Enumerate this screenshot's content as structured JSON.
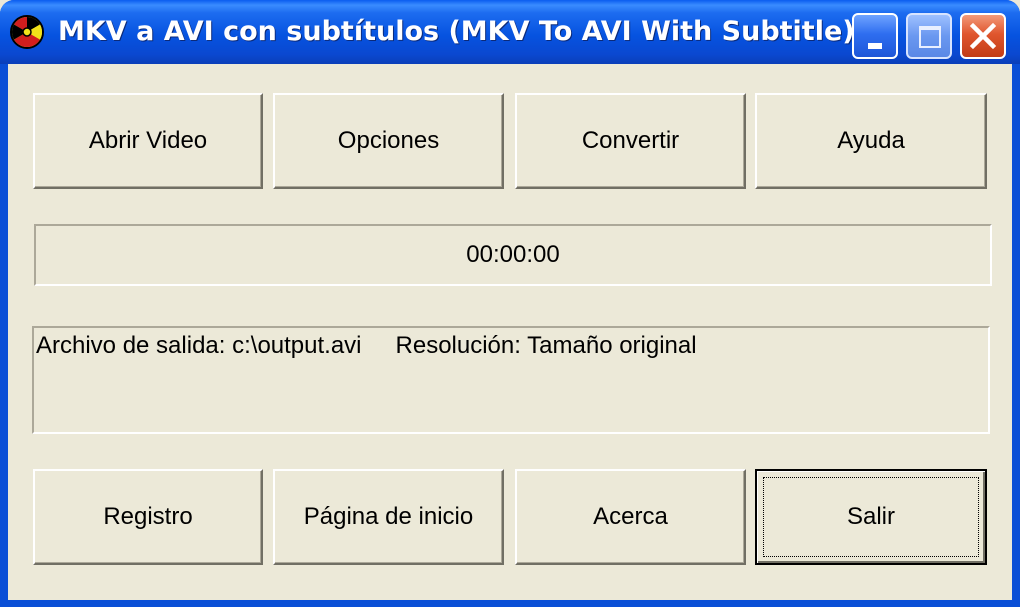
{
  "window": {
    "title": "MKV a AVI con subtítulos (MKV To AVI With Subtitle)",
    "app_icon": "radiation-icon",
    "controls": {
      "minimize": "minimize-icon",
      "maximize": "maximize-icon",
      "close": "close-icon"
    }
  },
  "toolbar": {
    "open_label": "Abrir Video",
    "options_label": "Opciones",
    "convert_label": "Convertir",
    "help_label": "Ayuda"
  },
  "status": {
    "time": "00:00:00",
    "output_file": "Archivo de salida: c:\\output.avi",
    "resolution": "Resolución: Tamaño original"
  },
  "footer": {
    "register_label": "Registro",
    "homepage_label": "Página de inicio",
    "about_label": "Acerca",
    "exit_label": "Salir"
  },
  "colors": {
    "titlebar": "#0a5cf0",
    "face": "#ece9d8",
    "close": "#e0562e"
  }
}
